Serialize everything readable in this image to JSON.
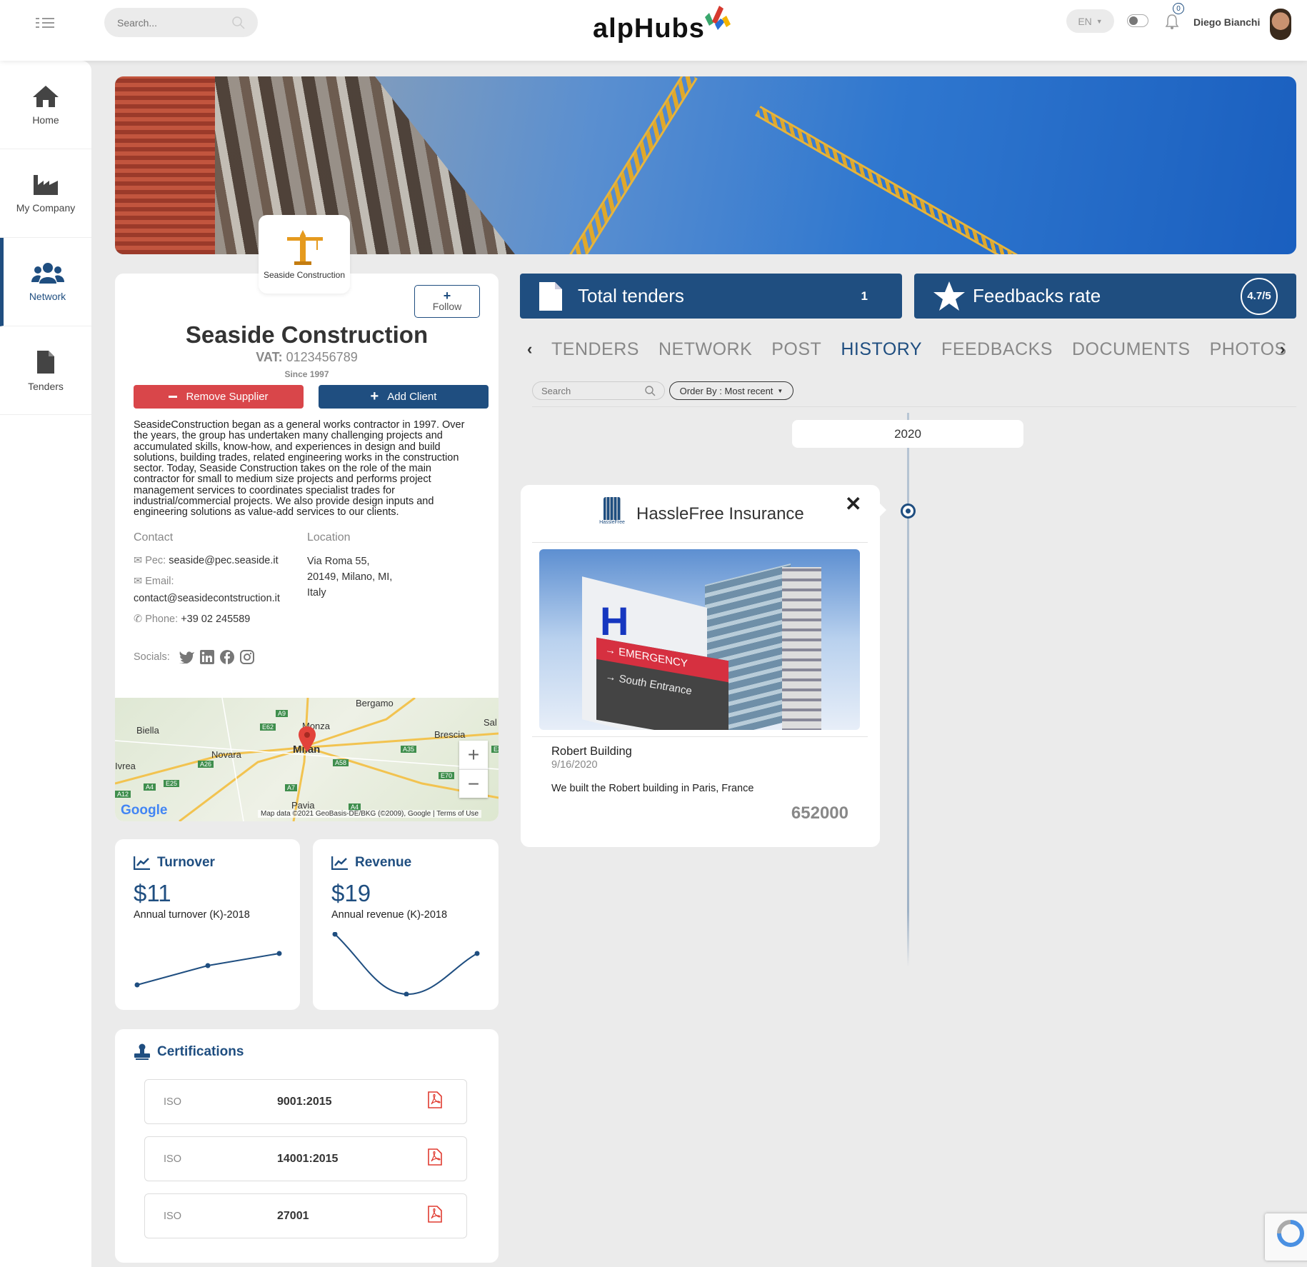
{
  "header": {
    "search_placeholder": "Search...",
    "logo": "alpHubs",
    "language": "EN",
    "notifications_count": "0",
    "user_name": "Diego Bianchi"
  },
  "sidebar": {
    "items": [
      {
        "label": "Home",
        "icon": "home-icon"
      },
      {
        "label": "My Company",
        "icon": "factory-icon"
      },
      {
        "label": "Network",
        "icon": "users-icon",
        "active": true
      },
      {
        "label": "Tenders",
        "icon": "file-icon"
      }
    ]
  },
  "company": {
    "logo_label": "Seaside Construction",
    "follow_label": "Follow",
    "name": "Seaside Construction",
    "vat_label": "VAT:",
    "vat": "0123456789",
    "since": "Since 1997",
    "remove_supplier": "Remove Supplier",
    "add_client": "Add Client",
    "description": "SeasideConstruction began as a general works contractor in 1997. Over the years, the group has undertaken many challenging projects and accumulated skills, know-how, and experiences in design and build solutions, building trades, related engineering works in the construction sector. Today, Seaside Construction takes on the role of the main contractor for small to medium size projects and performs project management services to coordinates specialist trades for industrial/commercial projects. We also provide design inputs and engineering solutions as value-add services to our clients.",
    "contact_title": "Contact",
    "pec_label": "Pec:",
    "pec": "seaside@pec.seaside.it",
    "email_label": "Email:",
    "email": "contact@seasidecontstruction.it",
    "phone_label": "Phone:",
    "phone": "+39 02 245589",
    "location_title": "Location",
    "address1": "Via Roma 55,",
    "address2": "20149, Milano, MI,",
    "address3": "Italy",
    "socials_label": "Socials:"
  },
  "map": {
    "labels": [
      "Bergamo",
      "Biella",
      "Monza",
      "Brescia",
      "Novara",
      "Milan",
      "Ivrea",
      "Pavia",
      "Sal"
    ],
    "roads": [
      "A9",
      "E62",
      "A4",
      "A26",
      "E25",
      "A7",
      "A58",
      "A35",
      "E70",
      "A4",
      "A12",
      "E35"
    ],
    "attribution": "Map data ©2021 GeoBasis-DE/BKG (©2009), Google",
    "terms": "Terms of Use",
    "google": "Google"
  },
  "turnover": {
    "title": "Turnover",
    "value": "$11",
    "caption": "Annual turnover (K)-2018"
  },
  "revenue": {
    "title": "Revenue",
    "value": "$19",
    "caption": "Annual revenue (K)-2018"
  },
  "certifications": {
    "title": "Certifications",
    "items": [
      {
        "type": "ISO",
        "code": "9001:2015"
      },
      {
        "type": "ISO",
        "code": "14001:2015"
      },
      {
        "type": "ISO",
        "code": "27001"
      }
    ]
  },
  "stats": {
    "tenders_label": "Total tenders",
    "tenders_value": "1",
    "feedback_label": "Feedbacks rate",
    "feedback_value": "4.7/5"
  },
  "tabs": [
    "TENDERS",
    "NETWORK",
    "POST",
    "HISTORY",
    "FEEDBACKS",
    "DOCUMENTS",
    "PHOTOS"
  ],
  "active_tab": "HISTORY",
  "filters": {
    "search_placeholder": "Search",
    "order_by": "Order By : Most recent"
  },
  "timeline": {
    "year": "2020",
    "entry": {
      "company": "HassleFree Insurance",
      "logo_text": "HassleFree Insurance",
      "title": "Robert Building",
      "date": "9/16/2020",
      "description": "We built the Robert building in Paris, France",
      "amount": "652000"
    }
  },
  "colors": {
    "primary": "#1f4e80",
    "danger": "#d9464a",
    "background": "#ebebeb"
  }
}
